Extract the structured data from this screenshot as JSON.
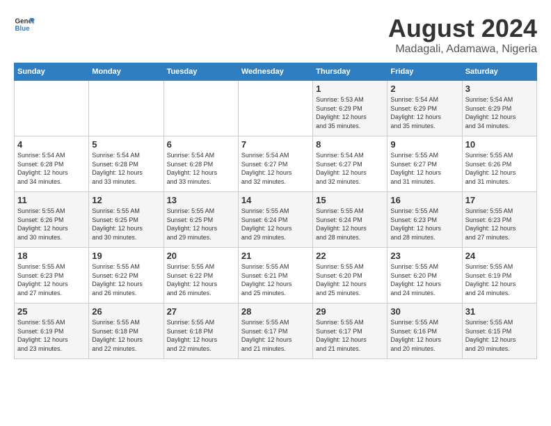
{
  "logo": {
    "text_general": "General",
    "text_blue": "Blue"
  },
  "header": {
    "title": "August 2024",
    "subtitle": "Madagali, Adamawa, Nigeria"
  },
  "weekdays": [
    "Sunday",
    "Monday",
    "Tuesday",
    "Wednesday",
    "Thursday",
    "Friday",
    "Saturday"
  ],
  "weeks": [
    [
      {
        "day": "",
        "detail": ""
      },
      {
        "day": "",
        "detail": ""
      },
      {
        "day": "",
        "detail": ""
      },
      {
        "day": "",
        "detail": ""
      },
      {
        "day": "1",
        "detail": "Sunrise: 5:53 AM\nSunset: 6:29 PM\nDaylight: 12 hours\nand 35 minutes."
      },
      {
        "day": "2",
        "detail": "Sunrise: 5:54 AM\nSunset: 6:29 PM\nDaylight: 12 hours\nand 35 minutes."
      },
      {
        "day": "3",
        "detail": "Sunrise: 5:54 AM\nSunset: 6:29 PM\nDaylight: 12 hours\nand 34 minutes."
      }
    ],
    [
      {
        "day": "4",
        "detail": "Sunrise: 5:54 AM\nSunset: 6:28 PM\nDaylight: 12 hours\nand 34 minutes."
      },
      {
        "day": "5",
        "detail": "Sunrise: 5:54 AM\nSunset: 6:28 PM\nDaylight: 12 hours\nand 33 minutes."
      },
      {
        "day": "6",
        "detail": "Sunrise: 5:54 AM\nSunset: 6:28 PM\nDaylight: 12 hours\nand 33 minutes."
      },
      {
        "day": "7",
        "detail": "Sunrise: 5:54 AM\nSunset: 6:27 PM\nDaylight: 12 hours\nand 32 minutes."
      },
      {
        "day": "8",
        "detail": "Sunrise: 5:54 AM\nSunset: 6:27 PM\nDaylight: 12 hours\nand 32 minutes."
      },
      {
        "day": "9",
        "detail": "Sunrise: 5:55 AM\nSunset: 6:27 PM\nDaylight: 12 hours\nand 31 minutes."
      },
      {
        "day": "10",
        "detail": "Sunrise: 5:55 AM\nSunset: 6:26 PM\nDaylight: 12 hours\nand 31 minutes."
      }
    ],
    [
      {
        "day": "11",
        "detail": "Sunrise: 5:55 AM\nSunset: 6:26 PM\nDaylight: 12 hours\nand 30 minutes."
      },
      {
        "day": "12",
        "detail": "Sunrise: 5:55 AM\nSunset: 6:25 PM\nDaylight: 12 hours\nand 30 minutes."
      },
      {
        "day": "13",
        "detail": "Sunrise: 5:55 AM\nSunset: 6:25 PM\nDaylight: 12 hours\nand 29 minutes."
      },
      {
        "day": "14",
        "detail": "Sunrise: 5:55 AM\nSunset: 6:24 PM\nDaylight: 12 hours\nand 29 minutes."
      },
      {
        "day": "15",
        "detail": "Sunrise: 5:55 AM\nSunset: 6:24 PM\nDaylight: 12 hours\nand 28 minutes."
      },
      {
        "day": "16",
        "detail": "Sunrise: 5:55 AM\nSunset: 6:23 PM\nDaylight: 12 hours\nand 28 minutes."
      },
      {
        "day": "17",
        "detail": "Sunrise: 5:55 AM\nSunset: 6:23 PM\nDaylight: 12 hours\nand 27 minutes."
      }
    ],
    [
      {
        "day": "18",
        "detail": "Sunrise: 5:55 AM\nSunset: 6:23 PM\nDaylight: 12 hours\nand 27 minutes."
      },
      {
        "day": "19",
        "detail": "Sunrise: 5:55 AM\nSunset: 6:22 PM\nDaylight: 12 hours\nand 26 minutes."
      },
      {
        "day": "20",
        "detail": "Sunrise: 5:55 AM\nSunset: 6:22 PM\nDaylight: 12 hours\nand 26 minutes."
      },
      {
        "day": "21",
        "detail": "Sunrise: 5:55 AM\nSunset: 6:21 PM\nDaylight: 12 hours\nand 25 minutes."
      },
      {
        "day": "22",
        "detail": "Sunrise: 5:55 AM\nSunset: 6:20 PM\nDaylight: 12 hours\nand 25 minutes."
      },
      {
        "day": "23",
        "detail": "Sunrise: 5:55 AM\nSunset: 6:20 PM\nDaylight: 12 hours\nand 24 minutes."
      },
      {
        "day": "24",
        "detail": "Sunrise: 5:55 AM\nSunset: 6:19 PM\nDaylight: 12 hours\nand 24 minutes."
      }
    ],
    [
      {
        "day": "25",
        "detail": "Sunrise: 5:55 AM\nSunset: 6:19 PM\nDaylight: 12 hours\nand 23 minutes."
      },
      {
        "day": "26",
        "detail": "Sunrise: 5:55 AM\nSunset: 6:18 PM\nDaylight: 12 hours\nand 22 minutes."
      },
      {
        "day": "27",
        "detail": "Sunrise: 5:55 AM\nSunset: 6:18 PM\nDaylight: 12 hours\nand 22 minutes."
      },
      {
        "day": "28",
        "detail": "Sunrise: 5:55 AM\nSunset: 6:17 PM\nDaylight: 12 hours\nand 21 minutes."
      },
      {
        "day": "29",
        "detail": "Sunrise: 5:55 AM\nSunset: 6:17 PM\nDaylight: 12 hours\nand 21 minutes."
      },
      {
        "day": "30",
        "detail": "Sunrise: 5:55 AM\nSunset: 6:16 PM\nDaylight: 12 hours\nand 20 minutes."
      },
      {
        "day": "31",
        "detail": "Sunrise: 5:55 AM\nSunset: 6:15 PM\nDaylight: 12 hours\nand 20 minutes."
      }
    ]
  ]
}
